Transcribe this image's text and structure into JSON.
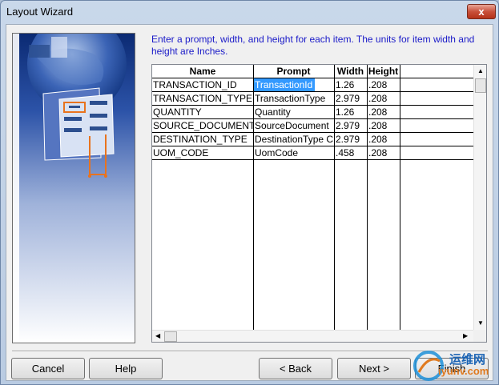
{
  "window": {
    "title": "Layout Wizard",
    "close_glyph": "x"
  },
  "instructions": "Enter a prompt, width, and height for each item. The units for item width and height are Inches.",
  "grid": {
    "columns": [
      "Name",
      "Prompt",
      "Width",
      "Height"
    ],
    "rows": [
      {
        "name": "TRANSACTION_ID",
        "prompt": "TransactionId",
        "width": "1.26",
        "height": ".208"
      },
      {
        "name": "TRANSACTION_TYPE",
        "prompt": "TransactionType",
        "width": "2.979",
        "height": ".208"
      },
      {
        "name": "QUANTITY",
        "prompt": "Quantity",
        "width": "1.26",
        "height": ".208"
      },
      {
        "name": "SOURCE_DOCUMENT",
        "prompt": "SourceDocument",
        "width": "2.979",
        "height": ".208"
      },
      {
        "name": "DESTINATION_TYPE",
        "prompt": "DestinationType C",
        "width": "2.979",
        "height": ".208"
      },
      {
        "name": "UOM_CODE",
        "prompt": "UomCode",
        "width": ".458",
        "height": ".208"
      }
    ],
    "selected_cell": "row 1, Prompt"
  },
  "buttons": {
    "cancel": "Cancel",
    "help": "Help",
    "back": "< Back",
    "next": "Next >",
    "finish": "Finish"
  },
  "watermark": {
    "top": "运维网",
    "bottom": "iyunv.com"
  },
  "colors": {
    "instruction_text": "#1a1ac8",
    "selection": "#3399ff",
    "title_bar": "#c9d8ea"
  }
}
